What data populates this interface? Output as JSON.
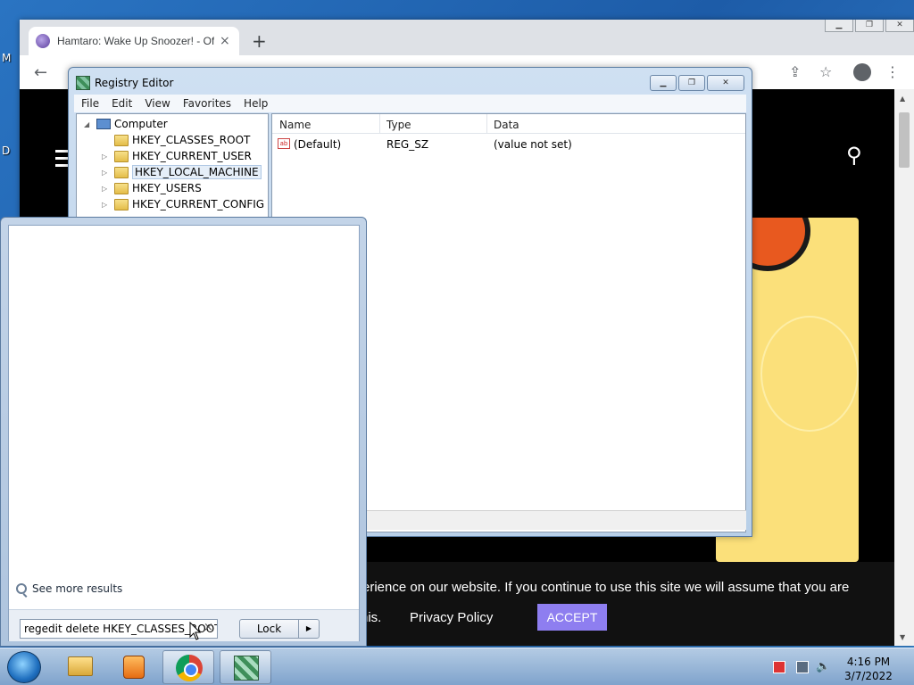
{
  "desktop": {
    "label_a": "M",
    "label_b": "D"
  },
  "browser": {
    "tab_title": "Hamtaro: Wake Up Snoozer! - Of",
    "new_tab_glyph": "+",
    "tab_close_glyph": "×",
    "site": {
      "cookie_text": "erience on our website. If you continue to use this site we will assume that you are",
      "cookie_text_2": "his.",
      "privacy_label": "Privacy Policy",
      "accept_label": "ACCEPT"
    }
  },
  "regedit": {
    "title": "Registry Editor",
    "menu": [
      "File",
      "Edit",
      "View",
      "Favorites",
      "Help"
    ],
    "tree": {
      "root": "Computer",
      "keys": [
        "HKEY_CLASSES_ROOT",
        "HKEY_CURRENT_USER",
        "HKEY_LOCAL_MACHINE",
        "HKEY_USERS",
        "HKEY_CURRENT_CONFIG"
      ],
      "selected": "HKEY_LOCAL_MACHINE"
    },
    "columns": [
      "Name",
      "Type",
      "Data"
    ],
    "rows": [
      {
        "name": "(Default)",
        "type": "REG_SZ",
        "data": "(value not set)"
      }
    ]
  },
  "start_menu": {
    "see_more": "See more results",
    "search_value": "regedit delete HKEY_CLASSES_ROOT",
    "lock_label": "Lock"
  },
  "taskbar": {
    "time": "4:16 PM",
    "date": "3/7/2022"
  }
}
